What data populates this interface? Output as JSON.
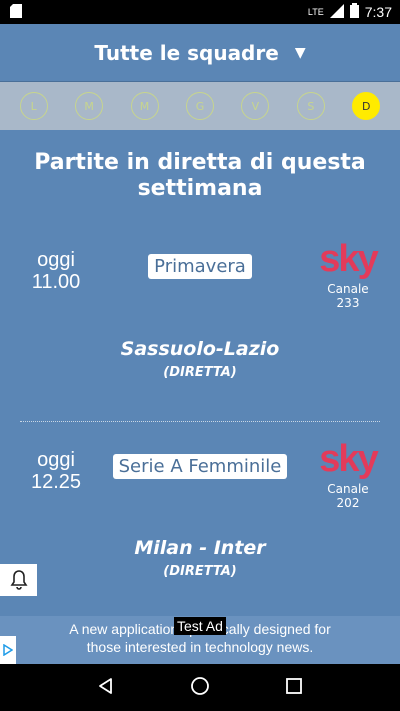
{
  "statusbar": {
    "time": "7:37",
    "network": "LTE"
  },
  "header": {
    "title": "Tutte le squadre"
  },
  "days": [
    {
      "label": "L",
      "active": false
    },
    {
      "label": "M",
      "active": false
    },
    {
      "label": "M",
      "active": false
    },
    {
      "label": "G",
      "active": false
    },
    {
      "label": "V",
      "active": false
    },
    {
      "label": "S",
      "active": false
    },
    {
      "label": "D",
      "active": true
    }
  ],
  "section": {
    "title_line1": "Partite in diretta di questa",
    "title_line2": "settimana"
  },
  "matches": [
    {
      "day": "oggi",
      "time": "11.00",
      "competition": "Primavera",
      "broadcaster": "sky",
      "channel": "Canale 233",
      "teams": "Sassuolo-Lazio",
      "status": "(DIRETTA)"
    },
    {
      "day": "oggi",
      "time": "12.25",
      "competition": "Serie A Femminile",
      "broadcaster": "sky",
      "channel": "Canale 202",
      "teams": "Milan - Inter",
      "status": "(DIRETTA)"
    }
  ],
  "ad": {
    "badge": "Test Ad",
    "line1": "A new application specifically designed for",
    "line2": "those interested in technology news."
  },
  "colors": {
    "background": "#5b86b5",
    "active_day": "#ffeb00",
    "sky_red": "#e33b5a"
  }
}
